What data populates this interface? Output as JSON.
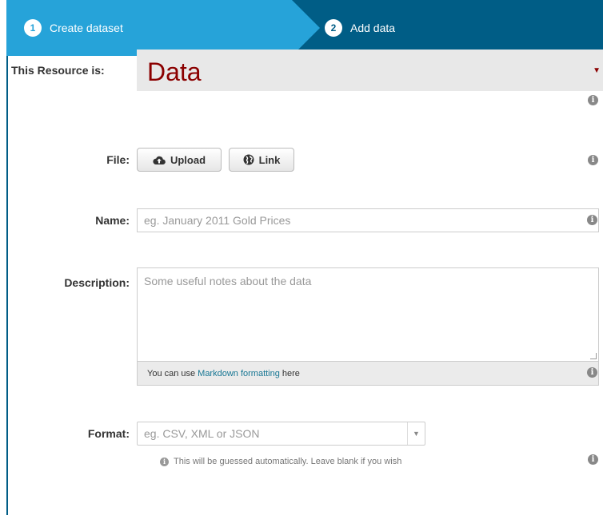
{
  "stages": [
    {
      "number": "1",
      "label": "Create dataset"
    },
    {
      "number": "2",
      "label": "Add data"
    }
  ],
  "resource": {
    "label": "This Resource is:",
    "value": "Data",
    "caret": "▼"
  },
  "file": {
    "label": "File:",
    "upload_label": "Upload",
    "link_label": "Link"
  },
  "name": {
    "label": "Name:",
    "placeholder": "eg. January 2011 Gold Prices"
  },
  "description": {
    "label": "Description:",
    "placeholder": "Some useful notes about the data",
    "markdown_prefix": "You can use",
    "markdown_link": "Markdown formatting",
    "markdown_suffix": "here"
  },
  "format": {
    "label": "Format:",
    "placeholder": "eg. CSV, XML or JSON",
    "hint": "This will be guessed automatically. Leave blank if you wish"
  },
  "info_glyph": "i",
  "colors": {
    "stage_active": "#26a3d9",
    "stage_dark": "#005d86",
    "resource_value": "#8b0000",
    "link": "#187794"
  }
}
